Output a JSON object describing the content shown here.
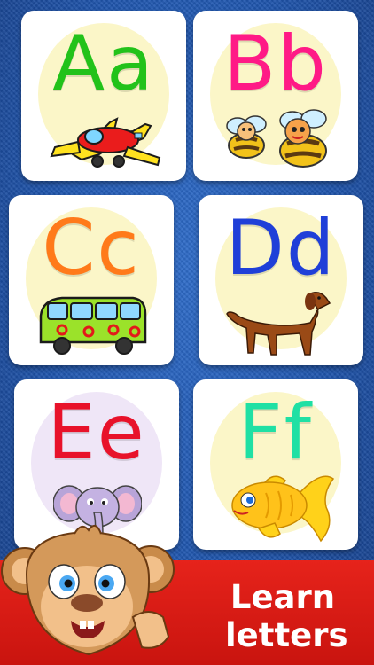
{
  "cards": [
    {
      "letters": "Aa",
      "color": "#22c21a",
      "circle": "#fbf6c8",
      "picture": "airplane-icon"
    },
    {
      "letters": "Bb",
      "color": "#ff1a86",
      "circle": "#fbf6c8",
      "picture": "bees-icon"
    },
    {
      "letters": "Cc",
      "color": "#ff7a1a",
      "circle": "#fbf6c8",
      "picture": "bus-icon"
    },
    {
      "letters": "Dd",
      "color": "#1f3fd8",
      "circle": "#fbf6c8",
      "picture": "dog-icon"
    },
    {
      "letters": "Ee",
      "color": "#e8122a",
      "circle": "#efe6f7",
      "picture": "elephant-icon"
    },
    {
      "letters": "Ff",
      "color": "#1fe0a4",
      "circle": "#fbf6c8",
      "picture": "fish-icon"
    }
  ],
  "banner": {
    "line1": "Learn",
    "line2": "letters",
    "color": "#e6231b"
  },
  "mascot": "monkey-icon"
}
